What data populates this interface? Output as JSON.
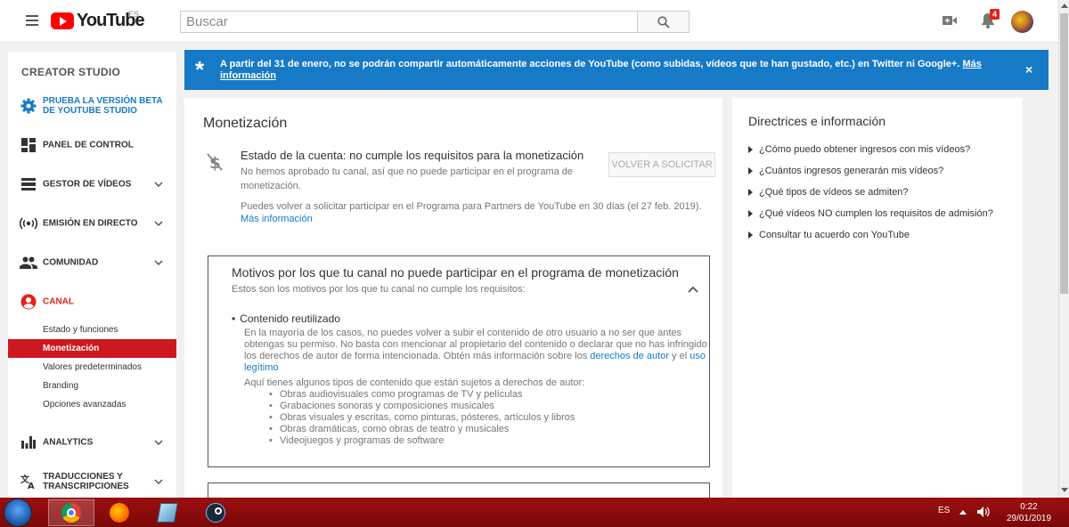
{
  "topbar": {
    "logo_text": "YouTube",
    "region": "ES",
    "search_placeholder": "Buscar",
    "notification_count": "4"
  },
  "sidebar": {
    "title": "CREATOR STUDIO",
    "beta_label": "PRUEBA LA VERSIÓN BETA DE YOUTUBE STUDIO",
    "items": [
      {
        "label": "PANEL DE CONTROL"
      },
      {
        "label": "GESTOR DE VÍDEOS"
      },
      {
        "label": "EMISIÓN EN DIRECTO"
      },
      {
        "label": "COMUNIDAD"
      },
      {
        "label": "CANAL"
      },
      {
        "label": "ANALYTICS"
      },
      {
        "label": "TRADUCCIONES Y TRANSCRIPCIONES"
      }
    ],
    "canal_subitems": [
      {
        "label": "Estado y funciones"
      },
      {
        "label": "Monetización"
      },
      {
        "label": "Valores predeterminados"
      },
      {
        "label": "Branding"
      },
      {
        "label": "Opciones avanzadas"
      }
    ]
  },
  "banner": {
    "star": "*",
    "message": "A partir del 31 de enero, no se podrán compartir automáticamente acciones de YouTube (como subidas, vídeos que te han gustado, etc.) en Twitter ni Google+.",
    "link": "Más información",
    "close": "×"
  },
  "main": {
    "title": "Monetización",
    "status_title": "Estado de la cuenta: no cumple los requisitos para la monetización",
    "status_desc": "No hemos aprobado tu canal, así que no puede participar en el programa de monetización.",
    "reapply_button": "VOLVER A SOLICITAR",
    "reapply_note": "Puedes volver a solicitar participar en el Programa para Partners de YouTube en 30 días (el 27 feb. 2019).",
    "reapply_link": "Más información",
    "reasons_title": "Motivos por los que tu canal no puede participar en el programa de monetización",
    "reasons_sub": "Estos son los motivos por los que tu canal no cumple los requisitos:",
    "reason_title": "Contenido reutilizado",
    "reason_desc": "En la mayoría de los casos, no puedes volver a subir el contenido de otro usuario a no ser que antes obtengas su permiso. No basta con mencionar al propietario del contenido o declarar que no has infringido los derechos de autor de forma intencionada. Obtén más información sobre los",
    "reason_link1": "derechos de autor",
    "reason_and": "y el",
    "reason_link2": "uso legítimo",
    "reason_list_intro": "Aquí tienes algunos tipos de contenido que están sujetos a derechos de autor:",
    "reason_list": [
      "Obras audiovisuales como programas de TV y películas",
      "Grabaciones sonoras y composiciones musicales",
      "Obras visuales y escritas, como pinturas, pósteres, artículos y libros",
      "Obras dramáticas, como obras de teatro y musicales",
      "Videojuegos y programas de software"
    ]
  },
  "right": {
    "title": "Directrices e información",
    "links": [
      "¿Cómo puedo obtener ingresos con mis vídeos?",
      "¿Cuántos ingresos generarán mis vídeos?",
      "¿Qué tipos de vídeos se admiten?",
      "¿Qué vídeos NO cumplen los requisitos de admisión?",
      "Consultar tu acuerdo con YouTube"
    ]
  },
  "taskbar": {
    "lang": "ES",
    "time": "0:22",
    "date": "29/01/2019"
  },
  "colors": {
    "accent_blue": "#167ac6",
    "youtube_red": "#ff0000",
    "active_red": "#cc181e",
    "taskbar_red": "#8b0c0c"
  }
}
